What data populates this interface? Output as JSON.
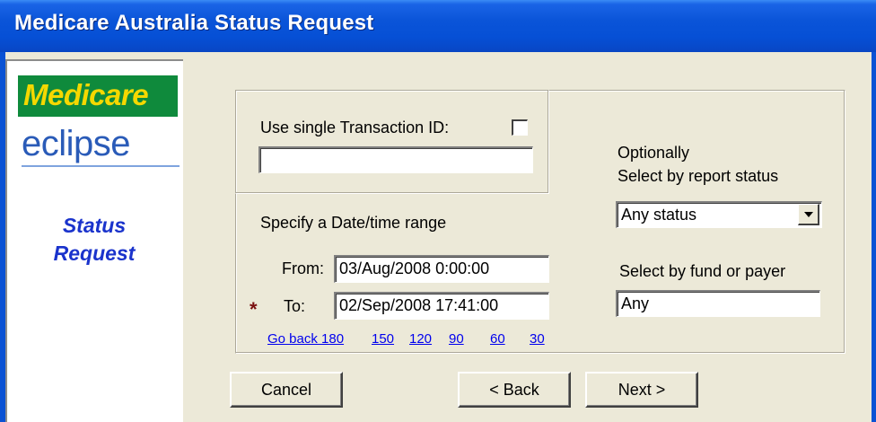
{
  "window": {
    "title": "Medicare Australia Status Request"
  },
  "sidebar": {
    "logo_top": "Medicare",
    "logo_bottom": "eclipse",
    "heading_line1": "Status",
    "heading_line2": "Request"
  },
  "transaction": {
    "label": "Use single Transaction ID:",
    "checkbox_checked": false,
    "input_value": ""
  },
  "date_range": {
    "heading": "Specify a Date/time range",
    "from_label": "From:",
    "from_value": "03/Aug/2008 0:00:00",
    "to_label": "To:",
    "to_value": "02/Sep/2008 17:41:00",
    "required_marker": "*",
    "go_back_links": [
      "Go back 180",
      "150",
      "120",
      "90",
      "60",
      "30"
    ]
  },
  "report_status": {
    "label_line1": "Optionally",
    "label_line2": "Select by report status",
    "selected": "Any status"
  },
  "fund": {
    "label": "Select by fund or payer",
    "value": "Any"
  },
  "buttons": {
    "cancel": "Cancel",
    "back": "< Back",
    "next": "Next >"
  }
}
